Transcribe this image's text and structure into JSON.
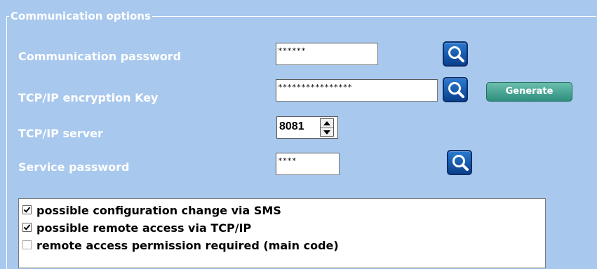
{
  "section": {
    "title": "Communication options"
  },
  "fields": {
    "comm_password": {
      "label": "Communication password",
      "value": "******"
    },
    "tcp_key": {
      "label": "TCP/IP encryption Key",
      "value": "****************"
    },
    "tcp_server": {
      "label": "TCP/IP server",
      "value": "8081"
    },
    "service_password": {
      "label": "Service password",
      "value": "****"
    }
  },
  "buttons": {
    "generate": "Generate"
  },
  "options": [
    {
      "label": "possible configuration change via SMS",
      "checked": true
    },
    {
      "label": "possible remote access via TCP/IP",
      "checked": true
    },
    {
      "label": "remote access permission required (main code)",
      "checked": false
    }
  ],
  "colors": {
    "background": "#a8c8ee",
    "icon_button": "#0a3f8c",
    "generate_button": "#2f8f7e"
  }
}
